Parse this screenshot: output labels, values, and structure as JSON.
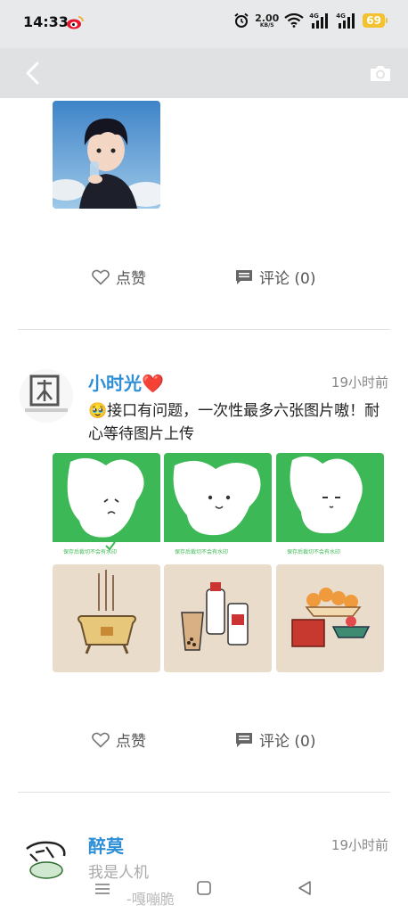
{
  "status_bar": {
    "time": "14:33",
    "net_speed_value": "2.00",
    "net_speed_unit": "KB/S",
    "sim1": "4G",
    "sim2": "4G",
    "battery": "69"
  },
  "navbar": {
    "back_icon": "chevron-left-icon",
    "camera_icon": "camera-icon"
  },
  "post1": {
    "like_label": "点赞",
    "comment_label": "评论 (0)"
  },
  "post2": {
    "author": "小时光❤️",
    "time": "19小时前",
    "emoji": "🥹",
    "text": "接口有问题，一次性最多六张图片嗷！耐心等待图片上传",
    "watermark": "保存后裁切不会有水印",
    "like_label": "点赞",
    "comment_label": "评论 (0)"
  },
  "post3": {
    "author": "醉莫",
    "time": "19小时前",
    "text": "我是人机",
    "sub_text": "-嘎嘣脆"
  },
  "colors": {
    "accent_name": "#2f8fd6",
    "sticker_green": "#3db856",
    "battery": "#f2c230"
  }
}
